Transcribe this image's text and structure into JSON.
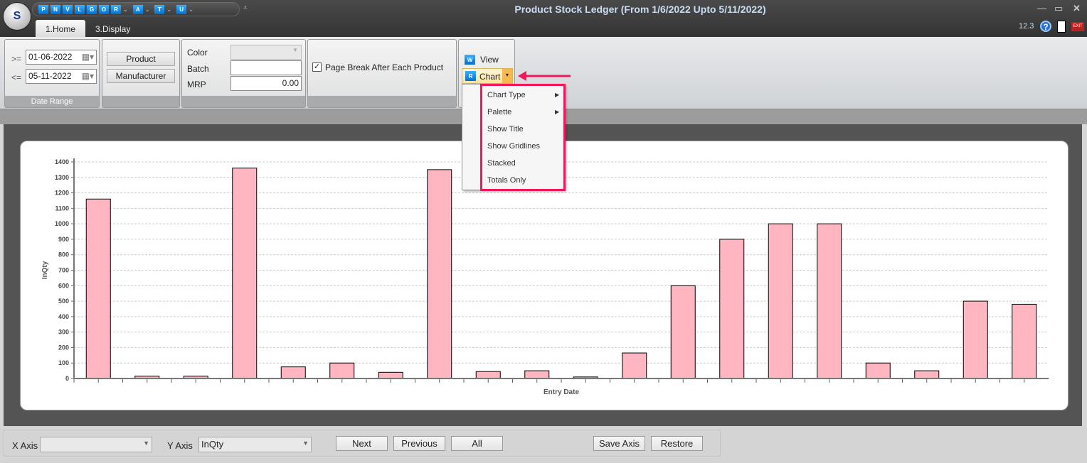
{
  "window": {
    "title": "Product Stock Ledger (From 1/6/2022 Upto 5/11/2022)",
    "version": "12.3",
    "logo_text": "S"
  },
  "quick_access": [
    {
      "label": "P"
    },
    {
      "label": "N"
    },
    {
      "label": "V"
    },
    {
      "label": "L"
    },
    {
      "label": "G"
    },
    {
      "label": "O"
    },
    {
      "label": "R",
      "dropdown": true
    },
    {
      "label": "A",
      "dropdown": true
    },
    {
      "label": "T",
      "dropdown": true
    },
    {
      "label": "U",
      "dropdown": true
    }
  ],
  "tabs": [
    {
      "label": "1.Home",
      "active": true
    },
    {
      "label": "3.Display"
    }
  ],
  "ribbon": {
    "date_range": {
      "caption": "Date Range",
      "from_op": ">=",
      "from": "01-06-2022",
      "to_op": "<=",
      "to": "05-11-2022"
    },
    "group_buttons": {
      "product": "Product",
      "manufacturer": "Manufacturer"
    },
    "filters": {
      "color_label": "Color",
      "color_value": "",
      "batch_label": "Batch",
      "batch_value": "",
      "mrp_label": "MRP",
      "mrp_value": "0.00"
    },
    "page_break": {
      "label": "Page Break After Each Product",
      "checked": true
    },
    "view_label": "View",
    "chart_label": "Chart"
  },
  "chart_menu": {
    "items": [
      {
        "label": "Chart Type",
        "submenu": true
      },
      {
        "label": "Palette",
        "submenu": true
      },
      {
        "label": "Show Title"
      },
      {
        "label": "Show Gridlines"
      },
      {
        "label": "Stacked"
      },
      {
        "label": "Totals Only"
      }
    ],
    "highlight_color": "#f0185a"
  },
  "chart_data": {
    "type": "bar",
    "xlabel": "Entry Date",
    "ylabel": "InQty",
    "ylim": [
      0,
      1400
    ],
    "yticks": [
      0,
      100,
      200,
      300,
      400,
      500,
      600,
      700,
      800,
      900,
      1000,
      1100,
      1200,
      1300,
      1400
    ],
    "grid": true,
    "bar_color": "#ffb6c1",
    "values": [
      1160,
      15,
      15,
      1360,
      75,
      100,
      40,
      1350,
      45,
      50,
      10,
      165,
      600,
      900,
      1000,
      1000,
      100,
      50,
      500,
      480
    ]
  },
  "bottom": {
    "x_axis_label": "X Axis",
    "x_axis_value": "",
    "y_axis_label": "Y Axis",
    "y_axis_value": "InQty",
    "next": "Next",
    "previous": "Previous",
    "all": "All",
    "save_axis": "Save Axis",
    "restore": "Restore"
  }
}
